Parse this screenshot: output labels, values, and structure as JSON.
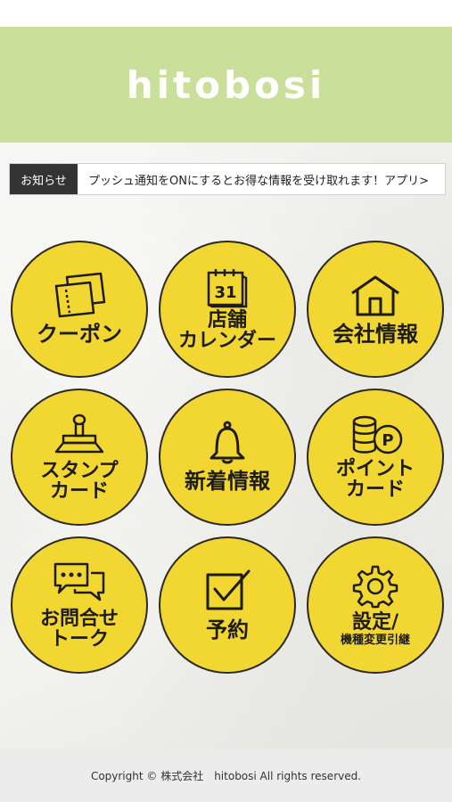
{
  "header": {
    "title": "hitobosi"
  },
  "news": {
    "label": "お知らせ",
    "text": "プッシュ通知をONにするとお得な情報を受け取れます！アプリ>"
  },
  "menu": [
    {
      "label": "クーポン",
      "icon": "coupon-icon"
    },
    {
      "label_line1": "店舗",
      "label_line2": "カレンダー",
      "icon": "calendar-icon",
      "calendar_number": "31"
    },
    {
      "label": "会社情報",
      "icon": "house-icon"
    },
    {
      "label_line1": "スタンプ",
      "label_line2": "カード",
      "icon": "stamp-icon"
    },
    {
      "label": "新着情報",
      "icon": "bell-icon"
    },
    {
      "label_line1": "ポイント",
      "label_line2": "カード",
      "icon": "points-coins-icon",
      "coin_letter": "P"
    },
    {
      "label_line1": "お問合せ",
      "label_line2": "トーク",
      "icon": "chat-bubbles-icon"
    },
    {
      "label": "予約",
      "icon": "checkbox-icon"
    },
    {
      "label_line1": "設定/",
      "label_line2": "機種変更引継",
      "icon": "gear-icon"
    }
  ],
  "colors": {
    "header_bg": "#c9df9a",
    "tile_fill": "#f2d632",
    "tile_outline": "#2d2a22",
    "news_label_bg": "#333333"
  },
  "footer": {
    "copyright": "Copyright © 株式会社　hitobosi All rights reserved."
  }
}
